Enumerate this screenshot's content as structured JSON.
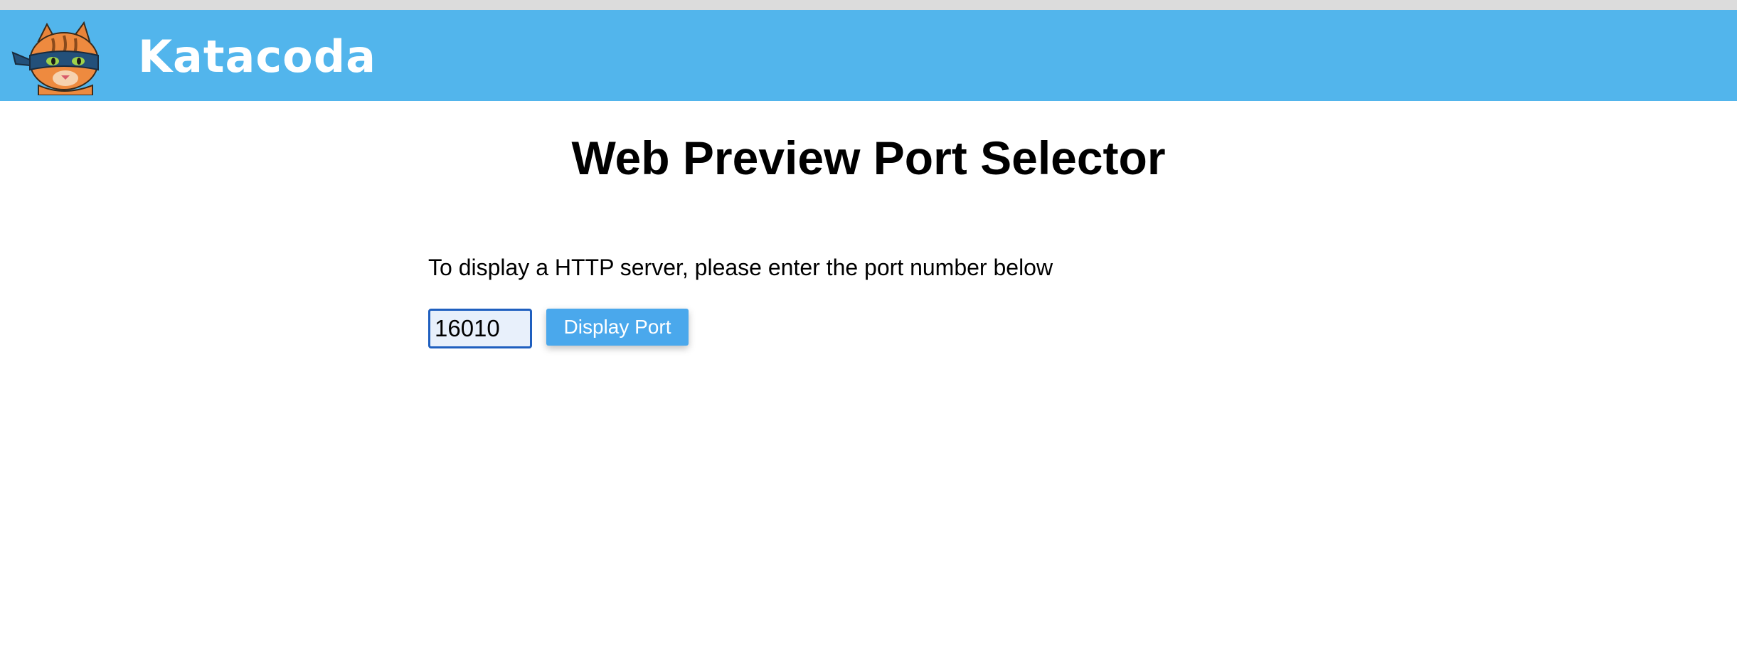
{
  "header": {
    "brand_name": "Katacoda",
    "logo_icon": "katacoda-ninja-cat-icon",
    "background_color": "#52b5ec"
  },
  "main": {
    "title": "Web Preview Port Selector",
    "instructions": "To display a HTTP server, please enter the port number below",
    "port_input": {
      "value": "16010"
    },
    "display_button_label": "Display Port",
    "button_color": "#4aa8ec"
  }
}
